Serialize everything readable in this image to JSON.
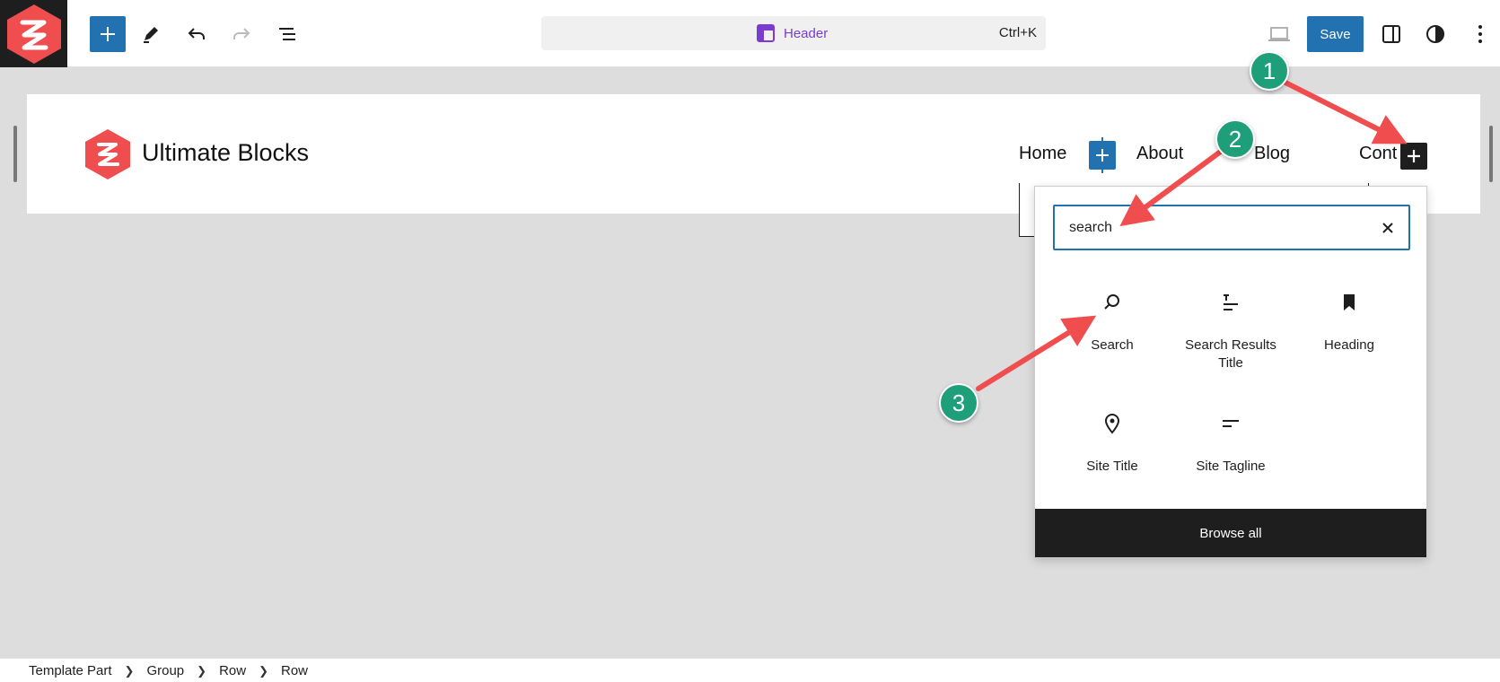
{
  "toolbar": {
    "document_title": "Header",
    "command_shortcut": "Ctrl+K",
    "save_label": "Save"
  },
  "canvas": {
    "site_title": "Ultimate Blocks",
    "nav": [
      "Home",
      "About",
      "Blog",
      "Cont"
    ]
  },
  "inserter": {
    "search_value": "search",
    "blocks": [
      {
        "label": "Search",
        "icon": "search-icon"
      },
      {
        "label": "Search Results Title",
        "icon": "query-title-icon"
      },
      {
        "label": "Heading",
        "icon": "bookmark-icon"
      },
      {
        "label": "Site Title",
        "icon": "map-pin-icon"
      },
      {
        "label": "Site Tagline",
        "icon": "tagline-icon"
      }
    ],
    "browse_all_label": "Browse all"
  },
  "annotations": {
    "step_1": "1",
    "step_2": "2",
    "step_3": "3",
    "arrow_color": "#f04e4e",
    "badge_color": "#1f9e7a"
  },
  "breadcrumb": [
    "Template Part",
    "Group",
    "Row",
    "Row"
  ],
  "colors": {
    "accent": "#2271b1",
    "template_purple": "#7a3ccf",
    "brand_red": "#f04e4e"
  }
}
